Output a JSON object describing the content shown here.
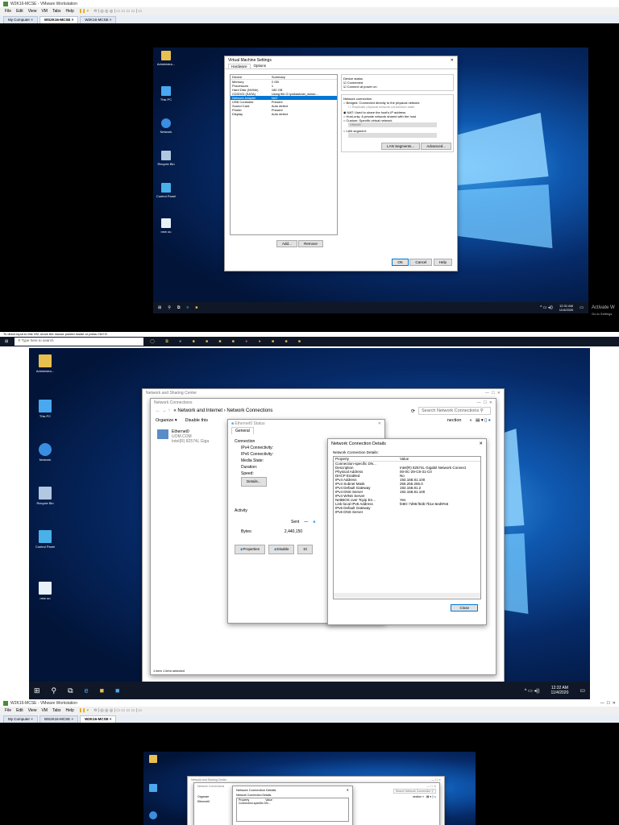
{
  "s1": {
    "title": "W2K16-MCSE - VMware Workstation",
    "menu": [
      "File",
      "Edit",
      "View",
      "VM",
      "Tabs",
      "Help"
    ],
    "tabs": [
      {
        "label": "My Computer"
      },
      {
        "label": "WS2K16-MCSE"
      },
      {
        "label": "W2K16-MCSE"
      }
    ],
    "desktop_icons": [
      "Administra...",
      "This PC",
      "Network",
      "Recycle Bin",
      "Control Panel",
      "new ou"
    ],
    "vm_settings": {
      "title": "Virtual Machine Settings",
      "tabs": [
        "Hardware",
        "Options"
      ],
      "headers": [
        "Device",
        "Summary"
      ],
      "devices": [
        [
          "Memory",
          "2 GB"
        ],
        [
          "Processors",
          "1"
        ],
        [
          "Hard Disk (NVMe)",
          "180 GB"
        ],
        [
          "CD/DVD (SATA)",
          "Using file G:\\yolkastrain_windo..."
        ],
        [
          "Network Adapter",
          "NAT"
        ],
        [
          "USB Controller",
          "Present"
        ],
        [
          "Sound Card",
          "Auto detect"
        ],
        [
          "Printer",
          "Present"
        ],
        [
          "Display",
          "Auto detect"
        ]
      ],
      "device_status": "Device status",
      "connected": "Connected",
      "connect_power": "Connect at power on",
      "net_conn": "Network connection",
      "options": [
        "Bridged: Connected directly to the physical network",
        "Replicate physical network connection state",
        "NAT: Used to share the host's IP address",
        "Host-only: A private network shared with the host",
        "Custom: Specific virtual network"
      ],
      "vmnet": "VMnet0",
      "lan_seg": "LAN segment:",
      "btn_lan": "LAN Segments...",
      "btn_adv": "Advanced...",
      "btn_add": "Add...",
      "btn_remove": "Remove",
      "btn_ok": "OK",
      "btn_cancel": "Cancel",
      "btn_help": "Help"
    },
    "clock_time": "12:31 AM",
    "clock_date": "11/4/2020",
    "activate": "Activate W",
    "activate2": "Go to Settings",
    "status": "To direct input to this VM, move the mouse pointer inside or press Ctrl+G.",
    "search": "Type here to search"
  },
  "s2": {
    "desktop_icons": [
      "Administra...",
      "This PC",
      "Network",
      "Recycle Bin",
      "Control Panel",
      "new ou"
    ],
    "nsc_title": "Network and Sharing Center",
    "nc_title": "Network Connections",
    "breadcrumb": "« Network and Internet › Network Connections",
    "search": "Search Network Connections",
    "organize": "Organize ▾",
    "disable": "Disable this",
    "section": "nection",
    "adapter_name": "Ethernet0",
    "adapter_domain": "UOM.COM",
    "adapter_hw": "Intel(R) 82574L Giga",
    "status_title": "Ethernet0 Status",
    "general": "General",
    "connection": "Connection",
    "conn_rows": [
      "IPv4 Connectivity:",
      "IPv6 Connectivity:",
      "Media State:",
      "Duration:",
      "Speed:"
    ],
    "details_btn": "Details...",
    "activity": "Activity",
    "sent": "Sent",
    "bytes": "Bytes:",
    "bytes_val": "2,440,150",
    "properties": "Properties",
    "disable_btn": "Disable",
    "diag": "Di",
    "footer": "1 item    1 item selected",
    "details_title": "Network Connection Details",
    "details_label": "Network Connection Details:",
    "col_prop": "Property",
    "col_val": "Value",
    "rows": [
      [
        "Connection-specific DN...",
        ""
      ],
      [
        "Description",
        "Intel(R) 82574L Gigabit Network Connect"
      ],
      [
        "Physical Address",
        "00-0C-29-C8-31-C0"
      ],
      [
        "DHCP Enabled",
        "No"
      ],
      [
        "IPv4 Address",
        "192.168.81.100"
      ],
      [
        "IPv4 Subnet Mask",
        "255.255.255.0"
      ],
      [
        "IPv4 Default Gateway",
        "192.168.81.2"
      ],
      [
        "IPv4 DNS Server",
        "192.168.81.100"
      ],
      [
        "IPv4 WINS Server",
        ""
      ],
      [
        "NetBIOS over Tcpip En...",
        "Yes"
      ],
      [
        "Link-local IPv6 Address",
        "fe80::7d96:f63b:7b1e:6ed9%5"
      ],
      [
        "IPv6 Default Gateway",
        ""
      ],
      [
        "IPv6 DNS Server",
        ""
      ]
    ],
    "close_btn": "Close",
    "clock_time": "12:32 AM",
    "clock_date": "11/4/2020"
  },
  "s3": {
    "title": "W2K16-MCSE - VMware Workstation",
    "menu": [
      "File",
      "Edit",
      "View",
      "VM",
      "Tabs",
      "Help"
    ],
    "tabs": [
      {
        "label": "My Computer"
      },
      {
        "label": "WS2K16-MCSE"
      },
      {
        "label": "W2K16-MCSE"
      }
    ],
    "nsc_title": "Network and Sharing Center",
    "nc_title": "Network Connections",
    "details_title": "Network Connection Details",
    "details_label": "Network Connection Details:",
    "col_prop": "Property",
    "col_val": "Value",
    "row1": "Connection-specific DN...",
    "organize": "Organize",
    "eth": "Ethernet0",
    "search": "Search Network Connection",
    "section": "nection"
  }
}
